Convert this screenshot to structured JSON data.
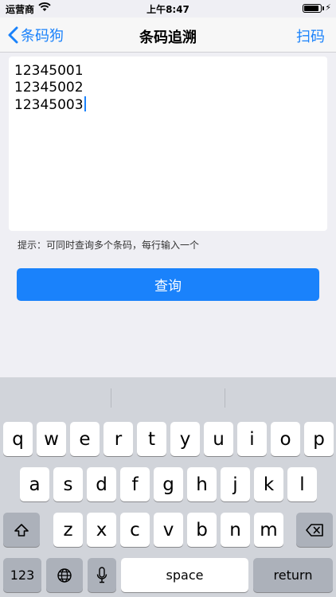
{
  "status_bar": {
    "carrier": "运营商",
    "time": "上午8:47",
    "battery_percent": 90
  },
  "nav": {
    "back_label": "条码狗",
    "title": "条码追溯",
    "right_label": "扫码"
  },
  "input": {
    "value": "12345001\n12345002\n12345003"
  },
  "hint": "提示：可同时查询多个条码，每行输入一个",
  "query_button": "查询",
  "keyboard": {
    "row1": [
      "q",
      "w",
      "e",
      "r",
      "t",
      "y",
      "u",
      "i",
      "o",
      "p"
    ],
    "row2": [
      "a",
      "s",
      "d",
      "f",
      "g",
      "h",
      "j",
      "k",
      "l"
    ],
    "row3": [
      "z",
      "x",
      "c",
      "v",
      "b",
      "n",
      "m"
    ],
    "numbers_label": "123",
    "space_label": "space",
    "return_label": "return"
  }
}
